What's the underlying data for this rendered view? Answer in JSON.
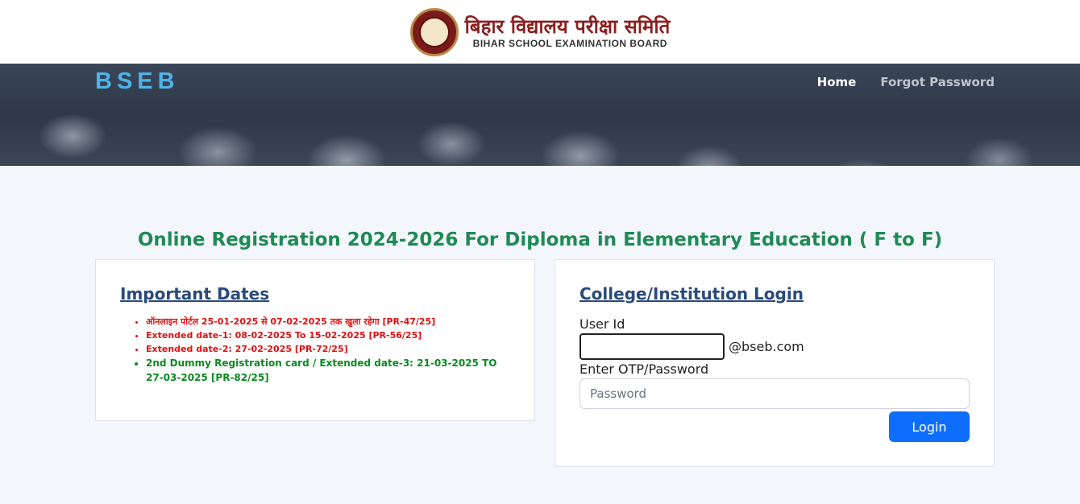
{
  "header": {
    "logo_hindi": "बिहार विद्यालय परीक्षा समिति",
    "logo_english": "BIHAR SCHOOL EXAMINATION BOARD"
  },
  "navbar": {
    "brand": "BSEB",
    "links": [
      {
        "label": "Home"
      },
      {
        "label": "Forgot Password"
      }
    ]
  },
  "page_title": "Online Registration 2024-2026 For Diploma in Elementary Education ( F to F)",
  "important_dates": {
    "title": "Important Dates",
    "items": [
      {
        "text": "ऑनलाइन पोर्टल 25-01-2025 से 07-02-2025 तक खुला रहेगा [PR-47/25]",
        "color": "#e01010"
      },
      {
        "text": "Extended date-1: 08-02-2025 To 15-02-2025 [PR-56/25]",
        "color": "#e01010"
      },
      {
        "text": "Extended date-2: 27-02-2025 [PR-72/25]",
        "color": "#e01010"
      },
      {
        "text": "2nd Dummy Registration card / Extended date-3: 21-03-2025 TO 27-03-2025 [PR-82/25]",
        "color": "#0b8a1f"
      }
    ]
  },
  "login": {
    "title": "College/Institution Login",
    "user_id_label": "User Id",
    "user_id_value": "",
    "domain_suffix": "@bseb.com",
    "password_label": "Enter OTP/Password",
    "password_placeholder": "Password",
    "submit_label": "Login"
  },
  "colors": {
    "brand": "#4fb3e8",
    "title_green": "#1f8a55",
    "card_title": "#2a4a7a",
    "button": "#0d6efd"
  }
}
